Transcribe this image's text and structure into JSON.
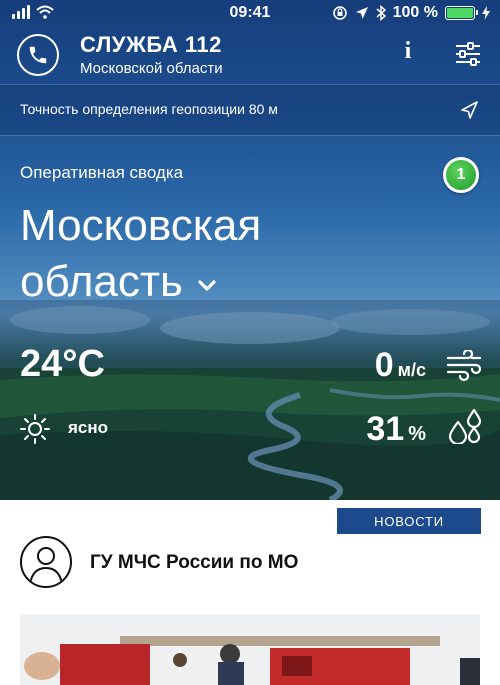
{
  "status_bar": {
    "time": "09:41",
    "battery_text": "100 %",
    "battery_level": 1.0,
    "icons": [
      "signal-icon",
      "wifi-icon",
      "orientation-lock-icon",
      "location-arrow-icon",
      "bluetooth-icon",
      "battery-icon",
      "charging-icon"
    ]
  },
  "header": {
    "title": "СЛУЖБА 112",
    "subtitle": "Московской области",
    "info_label": "i",
    "icons": [
      "phone-icon",
      "info-icon",
      "settings-sliders-icon"
    ]
  },
  "geo": {
    "text": "Точность определения геопозиции 80 м",
    "icon": "location-arrow-icon"
  },
  "summary": {
    "label": "Оперативная сводка",
    "badge_count": "1",
    "region_line1": "Московская",
    "region_line2": "область",
    "chevron_icon": "chevron-down-icon"
  },
  "weather": {
    "temperature": "24°C",
    "wind_value": "0",
    "wind_unit": "м/с",
    "condition": "ясно",
    "humidity_value": "31",
    "humidity_unit": "%",
    "icons": [
      "sun-icon",
      "wind-icon",
      "humidity-drops-icon"
    ]
  },
  "news": {
    "tab_label": "НОВОСТИ",
    "source": "ГУ МЧС России по МО",
    "avatar_icon": "user-avatar-icon"
  },
  "colors": {
    "header_blue": "#163d7c",
    "news_tab_blue": "#1c4a8c",
    "badge_green": "#1d9a2a",
    "battery_green": "#4cd964"
  }
}
